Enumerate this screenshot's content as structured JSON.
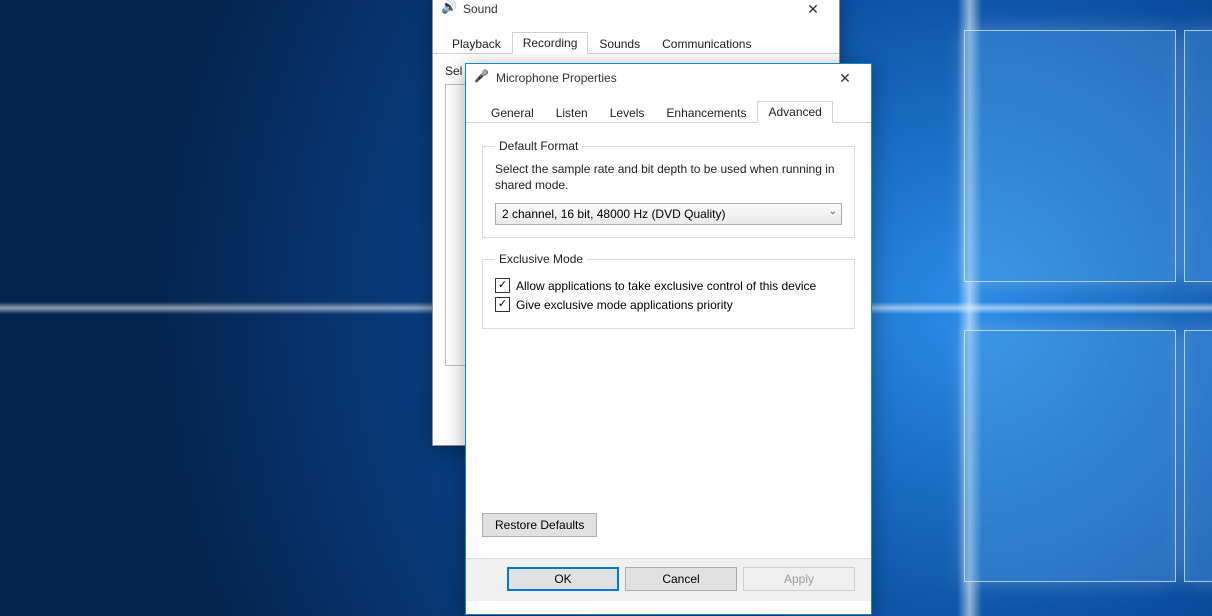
{
  "sound_window": {
    "title": "Sound",
    "tabs": [
      "Playback",
      "Recording",
      "Sounds",
      "Communications"
    ],
    "active_tab_index": 1,
    "body_hint_prefix": "Sel"
  },
  "mic_window": {
    "title": "Microphone Properties",
    "tabs": [
      "General",
      "Listen",
      "Levels",
      "Enhancements",
      "Advanced"
    ],
    "active_tab_index": 4,
    "default_format": {
      "legend": "Default Format",
      "help": "Select the sample rate and bit depth to be used when running in shared mode.",
      "selected": "2 channel, 16 bit, 48000 Hz (DVD Quality)"
    },
    "exclusive_mode": {
      "legend": "Exclusive Mode",
      "allow_label": "Allow applications to take exclusive control of this device",
      "allow_checked": true,
      "priority_label": "Give exclusive mode applications priority",
      "priority_checked": true
    },
    "restore_defaults_label": "Restore Defaults",
    "buttons": {
      "ok": "OK",
      "cancel": "Cancel",
      "apply": "Apply"
    }
  }
}
